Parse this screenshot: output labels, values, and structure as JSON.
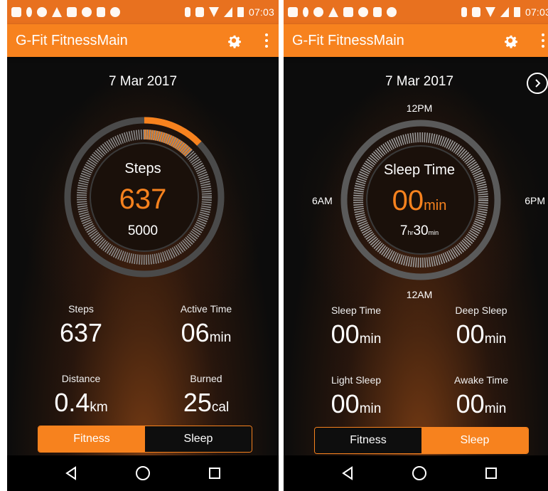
{
  "colors": {
    "accent": "#f7821e",
    "status_bar": "#e8711f",
    "background": "#0c0c0c"
  },
  "status_bar": {
    "left_icons": [
      "notification-icon",
      "mic-icon",
      "messenger-icon",
      "alert-icon",
      "gallery-icon",
      "whatsapp-icon",
      "tools-icon",
      "android-icon"
    ],
    "right_icons": [
      "bluetooth-icon",
      "vibrate-icon",
      "wifi-icon",
      "signal-icon",
      "battery-icon"
    ],
    "left_time": "07:03",
    "right_time": "07:03"
  },
  "left_screen": {
    "app_title": "G-Fit FitnessMain",
    "date": "7 Mar 2017",
    "ring": {
      "title": "Steps",
      "value": "637",
      "goal": "5000",
      "progress": 0.127
    },
    "stats": [
      {
        "label": "Steps",
        "value": "637",
        "unit": ""
      },
      {
        "label": "Active Time",
        "value": "06",
        "unit": "min"
      },
      {
        "label": "Distance",
        "value": "0.4",
        "unit": "km"
      },
      {
        "label": "Burned",
        "value": "25",
        "unit": "cal"
      }
    ],
    "tabs": [
      {
        "label": "Fitness",
        "active": true
      },
      {
        "label": "Sleep",
        "active": false
      }
    ]
  },
  "right_screen": {
    "app_title": "G-Fit FitnessMain",
    "date": "7 Mar 2017",
    "clock_labels": {
      "top": "12PM",
      "left": "6AM",
      "right": "6PM",
      "bottom": "12AM"
    },
    "ring": {
      "title": "Sleep Time",
      "value": "00",
      "value_unit": "min",
      "goal_hr": "7",
      "goal_hr_unit": "hr",
      "goal_min": "30",
      "goal_min_unit": "min"
    },
    "stats": [
      {
        "label": "Sleep Time",
        "value": "00",
        "unit": "min"
      },
      {
        "label": "Deep Sleep",
        "value": "00",
        "unit": "min"
      },
      {
        "label": "Light Sleep",
        "value": "00",
        "unit": "min"
      },
      {
        "label": "Awake Time",
        "value": "00",
        "unit": "min"
      }
    ],
    "tabs": [
      {
        "label": "Fitness",
        "active": false
      },
      {
        "label": "Sleep",
        "active": true
      }
    ]
  }
}
